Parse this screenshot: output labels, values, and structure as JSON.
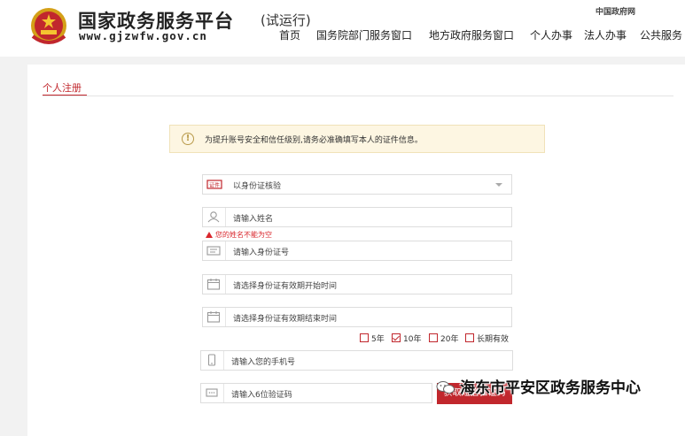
{
  "header": {
    "title": "国家政务服务平台",
    "subtitle": "(试运行)",
    "url": "www.gjzwfw.gov.cn",
    "gov_link": "中国政府网",
    "nav": [
      "首页",
      "国务院部门服务窗口",
      "地方政府服务窗口",
      "个人办事",
      "法人办事",
      "公共服务"
    ]
  },
  "page": {
    "tab": "个人注册",
    "notice": "为提升账号安全和信任级别,请务必准确填写本人的证件信息。"
  },
  "form": {
    "id_type": "以身份证核验",
    "name_placeholder": "请输入姓名",
    "name_error": "您的姓名不能为空",
    "id_number_placeholder": "请输入身份证号",
    "valid_start_placeholder": "请选择身份证有效期开始时间",
    "valid_end_placeholder": "请选择身份证有效期结束时间",
    "validity_options": [
      {
        "label": "5年",
        "checked": false
      },
      {
        "label": "10年",
        "checked": true
      },
      {
        "label": "20年",
        "checked": false
      },
      {
        "label": "长期有效",
        "checked": false
      }
    ],
    "phone_placeholder": "请输入您的手机号",
    "code_placeholder": "请输入6位验证码",
    "send_code_button": "获取短信验证码"
  },
  "watermark": "海东市平安区政务服务中心",
  "colors": {
    "accent": "#c1272d",
    "notice_bg": "#fdf6e2",
    "error": "#d9262c"
  }
}
